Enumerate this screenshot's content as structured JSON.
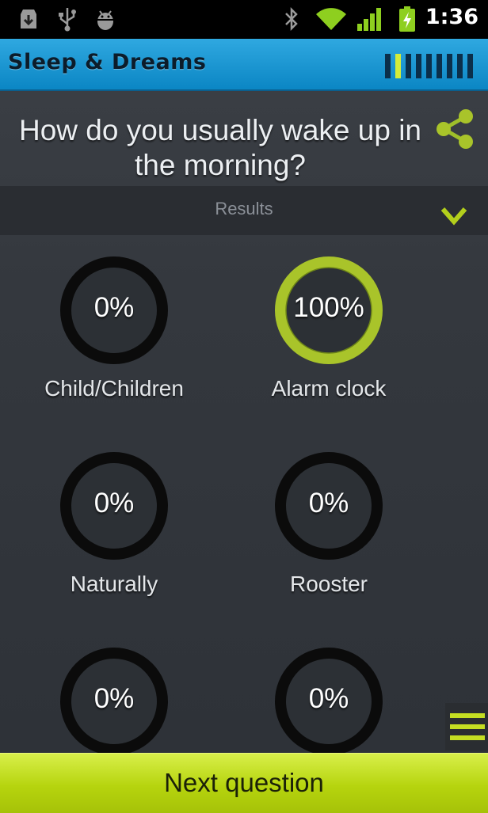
{
  "status_bar": {
    "time": "1:36",
    "left_icons": [
      "download-icon",
      "usb-icon",
      "android-debug-icon"
    ],
    "right_icons": [
      "bluetooth-icon",
      "wifi-icon",
      "signal-icon",
      "battery-charging-icon"
    ]
  },
  "action_bar": {
    "title": "Sleep & Dreams",
    "progress": {
      "current": 2,
      "total": 9
    }
  },
  "question": {
    "text": "How do you usually wake up in the morning?",
    "share_icon": "share-icon"
  },
  "results": {
    "label": "Results",
    "expand_icon": "chevron-down-icon",
    "options": [
      {
        "label": "Child/Children",
        "percent_text": "0%",
        "percent": 0
      },
      {
        "label": "Alarm clock",
        "percent_text": "100%",
        "percent": 100
      },
      {
        "label": "Naturally",
        "percent_text": "0%",
        "percent": 0
      },
      {
        "label": "Rooster",
        "percent_text": "0%",
        "percent": 0
      },
      {
        "label": "",
        "percent_text": "0%",
        "percent": 0
      },
      {
        "label": "",
        "percent_text": "0%",
        "percent": 0
      }
    ]
  },
  "menu_icon": "menu-icon",
  "next_button": {
    "label": "Next question"
  },
  "colors": {
    "accent": "#b8d412",
    "action_bar": "#1a96d2",
    "ring_empty": "#0b0b0b",
    "ring_filled": "#a9c42a"
  }
}
